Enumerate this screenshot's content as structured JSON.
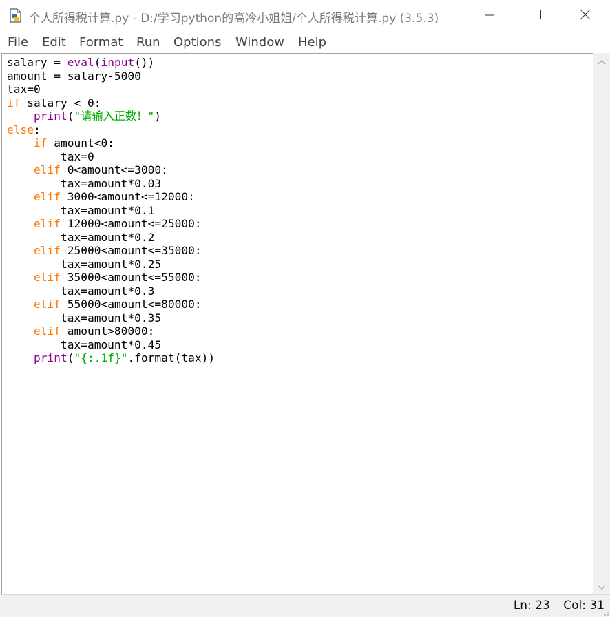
{
  "window": {
    "title": "个人所得税计算.py - D:/学习python的高冷小姐姐/个人所得税计算.py (3.5.3)",
    "icons": {
      "app": "python-file-icon",
      "minimize": "minimize-icon",
      "maximize": "maximize-icon",
      "close": "close-icon"
    }
  },
  "menu": {
    "items": [
      {
        "label": "File"
      },
      {
        "label": "Edit"
      },
      {
        "label": "Format"
      },
      {
        "label": "Run"
      },
      {
        "label": "Options"
      },
      {
        "label": "Window"
      },
      {
        "label": "Help"
      }
    ]
  },
  "editor": {
    "colors": {
      "keyword": "#ff7700",
      "builtin": "#900090",
      "string": "#00aa00",
      "text": "#000000"
    },
    "lines": [
      [
        {
          "t": "salary = "
        },
        {
          "t": "eval",
          "c": "bi"
        },
        {
          "t": "("
        },
        {
          "t": "input",
          "c": "bi"
        },
        {
          "t": "())"
        }
      ],
      [
        {
          "t": "amount = salary-5000"
        }
      ],
      [
        {
          "t": "tax=0"
        }
      ],
      [
        {
          "t": "if",
          "c": "kw"
        },
        {
          "t": " salary < 0:"
        }
      ],
      [
        {
          "t": "    "
        },
        {
          "t": "print",
          "c": "bi"
        },
        {
          "t": "("
        },
        {
          "t": "\"请输入正数！\"",
          "c": "st"
        },
        {
          "t": ")"
        }
      ],
      [
        {
          "t": "else",
          "c": "kw"
        },
        {
          "t": ":"
        }
      ],
      [
        {
          "t": "    "
        },
        {
          "t": "if",
          "c": "kw"
        },
        {
          "t": " amount<0:"
        }
      ],
      [
        {
          "t": "        tax=0"
        }
      ],
      [
        {
          "t": "    "
        },
        {
          "t": "elif",
          "c": "kw"
        },
        {
          "t": " 0<amount<=3000:"
        }
      ],
      [
        {
          "t": "        tax=amount*0.03"
        }
      ],
      [
        {
          "t": "    "
        },
        {
          "t": "elif",
          "c": "kw"
        },
        {
          "t": " 3000<amount<=12000:"
        }
      ],
      [
        {
          "t": "        tax=amount*0.1"
        }
      ],
      [
        {
          "t": "    "
        },
        {
          "t": "elif",
          "c": "kw"
        },
        {
          "t": " 12000<amount<=25000:"
        }
      ],
      [
        {
          "t": "        tax=amount*0.2"
        }
      ],
      [
        {
          "t": "    "
        },
        {
          "t": "elif",
          "c": "kw"
        },
        {
          "t": " 25000<amount<=35000:"
        }
      ],
      [
        {
          "t": "        tax=amount*0.25"
        }
      ],
      [
        {
          "t": "    "
        },
        {
          "t": "elif",
          "c": "kw"
        },
        {
          "t": " 35000<amount<=55000:"
        }
      ],
      [
        {
          "t": "        tax=amount*0.3"
        }
      ],
      [
        {
          "t": "    "
        },
        {
          "t": "elif",
          "c": "kw"
        },
        {
          "t": " 55000<amount<=80000:"
        }
      ],
      [
        {
          "t": "        tax=amount*0.35"
        }
      ],
      [
        {
          "t": "    "
        },
        {
          "t": "elif",
          "c": "kw"
        },
        {
          "t": " amount>80000:"
        }
      ],
      [
        {
          "t": "        tax=amount*0.45"
        }
      ],
      [
        {
          "t": "    "
        },
        {
          "t": "print",
          "c": "bi"
        },
        {
          "t": "("
        },
        {
          "t": "\"{:.1f}\"",
          "c": "st"
        },
        {
          "t": ".format(tax))"
        }
      ]
    ]
  },
  "scrollbar": {
    "up_icon": "scroll-up-arrow-icon",
    "down_icon": "scroll-down-arrow-icon"
  },
  "status": {
    "line": "Ln: 23",
    "col": "Col: 31"
  }
}
